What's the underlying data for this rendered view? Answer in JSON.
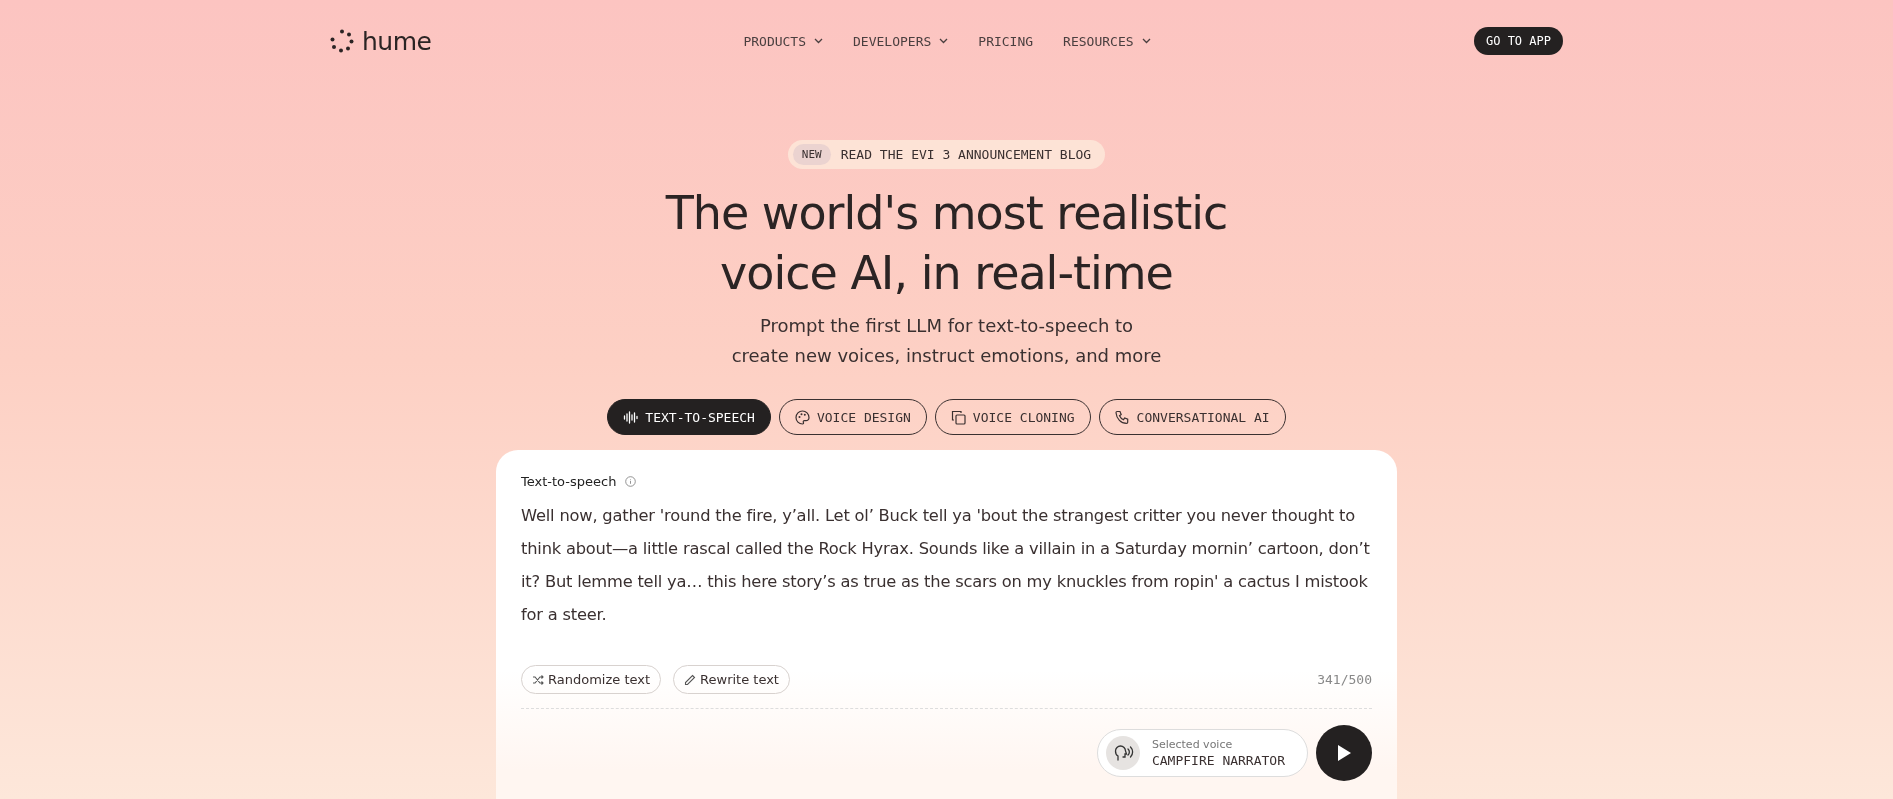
{
  "nav": {
    "logo": "hume",
    "links": [
      {
        "label": "PRODUCTS",
        "dropdown": true
      },
      {
        "label": "DEVELOPERS",
        "dropdown": true
      },
      {
        "label": "PRICING",
        "dropdown": false
      },
      {
        "label": "RESOURCES",
        "dropdown": true
      }
    ],
    "cta": "GO TO APP"
  },
  "hero": {
    "badge": "NEW",
    "announcement": "READ THE EVI 3 ANNOUNCEMENT BLOG",
    "title_lines": [
      "The world's most realistic",
      "voice AI, in real-time"
    ],
    "subtitle_lines": [
      "Prompt the first LLM for text-to-speech to",
      "create new voices, instruct emotions, and more"
    ]
  },
  "tabs": [
    {
      "label": "TEXT-TO-SPEECH",
      "kind": "wave",
      "selected": true
    },
    {
      "label": "VOICE DESIGN",
      "kind": "palette",
      "selected": false
    },
    {
      "label": "VOICE CLONING",
      "kind": "copy",
      "selected": false
    },
    {
      "label": "CONVERSATIONAL AI",
      "kind": "phone",
      "selected": false
    }
  ],
  "card": {
    "label": "Text-to-speech",
    "text": "Well now, gather 'round the fire, y’all. Let ol’ Buck tell ya 'bout the strangest critter you never thought to think about—a little rascal called the Rock Hyrax. Sounds like a villain in a Saturday mornin’ cartoon, don’t it? But lemme tell ya… this here story’s as true as the scars on my knuckles from ropin' a cactus I mistook for a steer.",
    "actions": [
      {
        "label": "Randomize text",
        "kind": "shuffle"
      },
      {
        "label": "Rewrite text",
        "kind": "pencil"
      }
    ],
    "count": "341/500",
    "voice_caption": "Selected voice",
    "voice_name": "CAMPFIRE NARRATOR"
  }
}
